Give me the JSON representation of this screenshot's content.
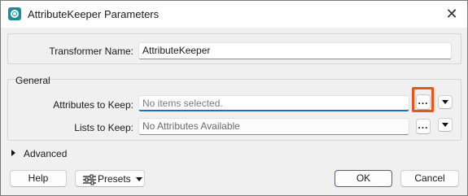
{
  "window": {
    "title": "AttributeKeeper Parameters",
    "close_glyph": "✕"
  },
  "transformer": {
    "label": "Transformer Name:",
    "value": "AttributeKeeper"
  },
  "general": {
    "group_label": "General",
    "attributes_to_keep": {
      "label": "Attributes to Keep:",
      "placeholder": "No items selected.",
      "browse_label": "..."
    },
    "lists_to_keep": {
      "label": "Lists to Keep:",
      "value": "No Attributes Available",
      "browse_label": "..."
    }
  },
  "advanced": {
    "label": "Advanced"
  },
  "footer": {
    "help_label": "Help",
    "presets_label": "Presets",
    "ok_label": "OK",
    "cancel_label": "Cancel"
  },
  "colors": {
    "highlight": "#e8541c",
    "focus_accent": "#1a6fc4",
    "app_icon": "#1f8a9a"
  },
  "icons": {
    "app": "fme-app-icon",
    "close": "close-icon",
    "presets": "sliders-icon",
    "expander": "triangle-right-icon",
    "dropdown": "triangle-down-icon"
  }
}
